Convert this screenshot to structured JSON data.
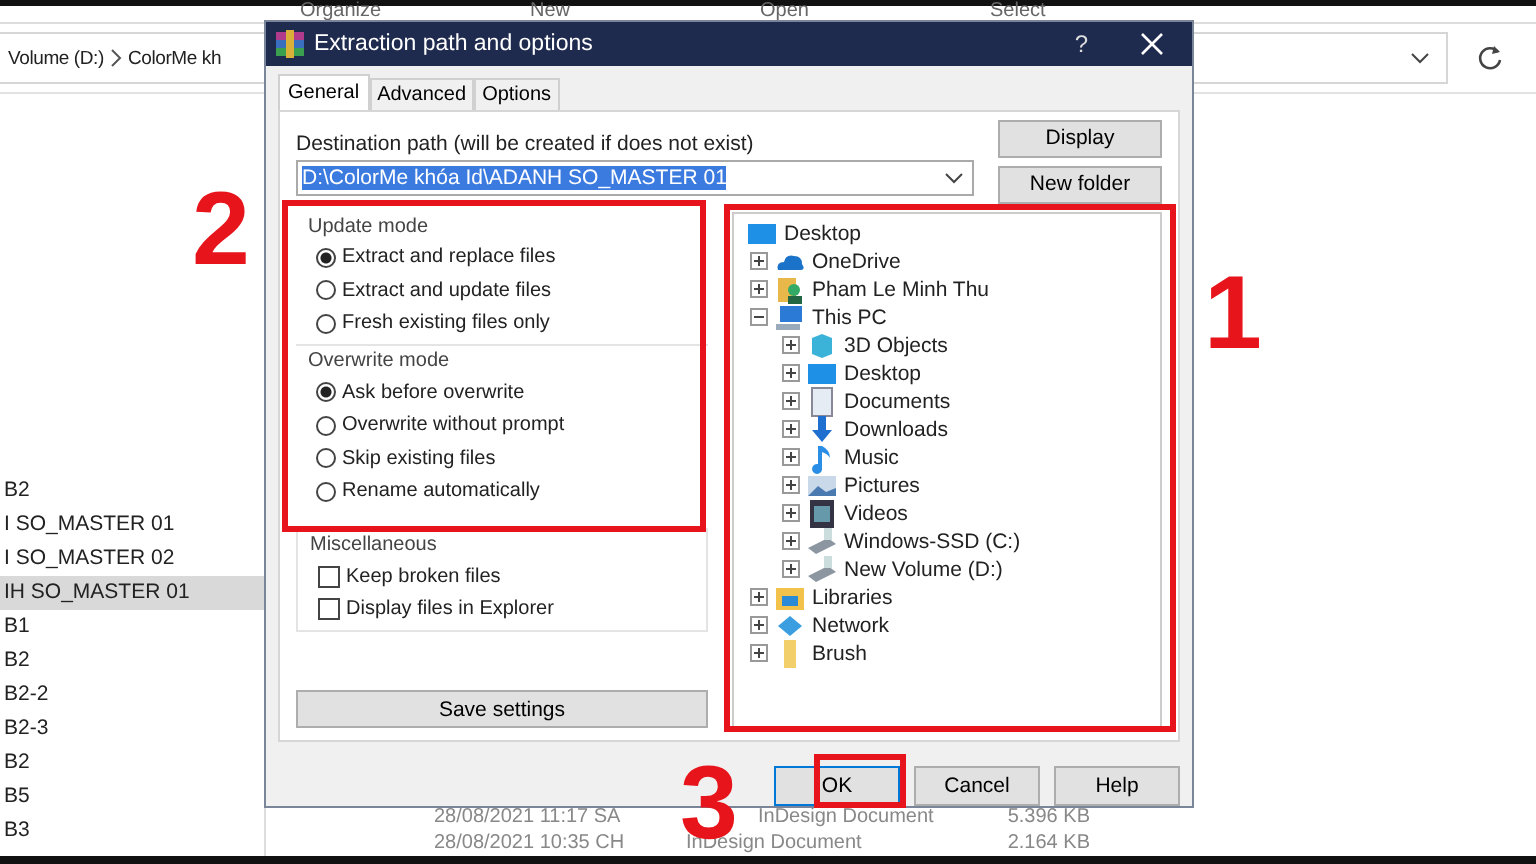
{
  "explorer": {
    "toolbar": [
      "Organize",
      "New",
      "Open",
      "Select"
    ],
    "address": {
      "crumbs": [
        "Volume (D:)",
        "ColorMe kh"
      ]
    },
    "nav_items": [
      {
        "label": "B2",
        "selected": false
      },
      {
        "label": "I SO_MASTER 01",
        "selected": false
      },
      {
        "label": "I SO_MASTER 02",
        "selected": false
      },
      {
        "label": "IH SO_MASTER 01",
        "selected": true
      },
      {
        "label": "B1",
        "selected": false
      },
      {
        "label": "B2",
        "selected": false
      },
      {
        "label": "B2-2",
        "selected": false
      },
      {
        "label": "B2-3",
        "selected": false
      },
      {
        "label": "B2",
        "selected": false
      },
      {
        "label": "B5",
        "selected": false
      },
      {
        "label": "B3",
        "selected": false
      }
    ],
    "files": [
      {
        "date": "28/08/2021 11:17 SA",
        "type": "InDesign Document",
        "size": "5.396 KB"
      },
      {
        "date": "28/08/2021 10:35 CH",
        "type": "InDesign Document",
        "size": "2.164 KB"
      }
    ]
  },
  "dialog": {
    "title": "Extraction path and options",
    "help": "?",
    "tabs": [
      {
        "label": "General",
        "selected": true
      },
      {
        "label": "Advanced",
        "selected": false
      },
      {
        "label": "Options",
        "selected": false
      }
    ],
    "destination_label": "Destination path (will be created if does not exist)",
    "destination": {
      "value": "D:\\ColorMe khóa Id\\ADANH SO_MASTER 01",
      "highlighted": true
    },
    "side_buttons": [
      "Display",
      "New folder"
    ],
    "update_mode": {
      "title": "Update mode",
      "options": [
        {
          "label": "Extract and replace files",
          "selected": true
        },
        {
          "label": "Extract and update files",
          "selected": false
        },
        {
          "label": "Fresh existing files only",
          "selected": false
        }
      ]
    },
    "overwrite_mode": {
      "title": "Overwrite mode",
      "options": [
        {
          "label": "Ask before overwrite",
          "selected": true
        },
        {
          "label": "Overwrite without prompt",
          "selected": false
        },
        {
          "label": "Skip existing files",
          "selected": false
        },
        {
          "label": "Rename automatically",
          "selected": false
        }
      ]
    },
    "miscellaneous": {
      "title": "Miscellaneous",
      "options": [
        {
          "label": "Keep broken files",
          "checked": false
        },
        {
          "label": "Display files in Explorer",
          "checked": false
        }
      ]
    },
    "save_button": "Save settings",
    "tree": {
      "label": "Desktop",
      "children": [
        {
          "label": "OneDrive",
          "expanded": false
        },
        {
          "label": "Pham Le Minh Thu",
          "expanded": false
        },
        {
          "label": "This PC",
          "expanded": true,
          "children": [
            {
              "label": "3D Objects",
              "expanded": false
            },
            {
              "label": "Desktop",
              "expanded": false
            },
            {
              "label": "Documents",
              "expanded": false
            },
            {
              "label": "Downloads",
              "expanded": false
            },
            {
              "label": "Music",
              "expanded": false
            },
            {
              "label": "Pictures",
              "expanded": false
            },
            {
              "label": "Videos",
              "expanded": false
            },
            {
              "label": "Windows-SSD (C:)",
              "expanded": false
            },
            {
              "label": "New Volume (D:)",
              "expanded": false
            }
          ]
        },
        {
          "label": "Libraries",
          "expanded": false
        },
        {
          "label": "Network",
          "expanded": false
        },
        {
          "label": "Brush",
          "expanded": false
        }
      ]
    },
    "buttons": [
      {
        "label": "OK",
        "kind": "default"
      },
      {
        "label": "Cancel",
        "kind": "normal"
      },
      {
        "label": "Help",
        "kind": "normal"
      }
    ]
  },
  "annotations": [
    "1",
    "2",
    "3"
  ]
}
